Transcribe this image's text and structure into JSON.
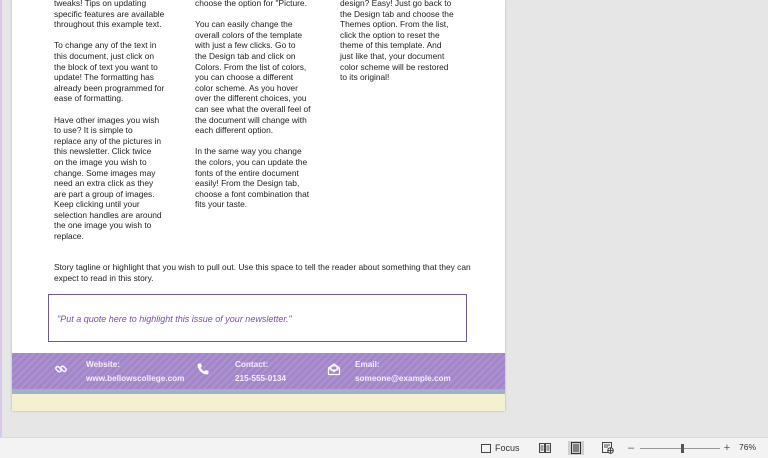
{
  "document": {
    "column1": [
      "tweaks!  Tips on updating\nspecific features are available\nthroughout this example text.",
      "To change any of the text in\nthis document, just click on\nthe block of text you want to\nupdate!  The formatting has\nalready been programmed for\nease of formatting.",
      "Have other images you wish\nto use?  It is simple to\nreplace any of the pictures in\nthis newsletter.  Click twice\non the image you wish to\nchange.  Some images may\nneed an extra click as they\nare part a group of images.\nKeep clicking until your\nselection handles are around\nthe one image you wish to\nreplace."
    ],
    "column2": [
      "choose the option for \"Picture.",
      "You can easily change the\noverall colors of the template\nwith just a few clicks.  Go to\nthe Design tab and click on\nColors.  From the list of colors,\nyou can choose a different\ncolor scheme.  As you hover\nover the different choices, you\ncan see what the overall feel of\nthe document will change with\neach different option.",
      "In the same way you change\nthe colors, you can update the\nfonts of the entire document\neasily!  From the Design tab,\nchoose a font combination that\nfits your taste."
    ],
    "column3": [
      "design?  Easy!  Just go back to\nthe Design tab and choose the\nThemes option.  From the list,\nclick the option to reset the\ntheme of this template.  And\njust like that, your document\ncolor scheme will be restored\nto its original!"
    ],
    "tagline": "Story tagline or highlight that you wish to pull out.  Use this space to tell the reader about something that they can expect to read in this story.",
    "quote": "\"Put a quote here to highlight this issue of your newsletter.\"",
    "footer": {
      "website_label": "Website:",
      "website_value": "www.bellowscollege.com",
      "contact_label": "Contact:",
      "contact_value": "215-555-0134",
      "email_label": "Email:",
      "email_value": "someone@example.com",
      "band_color": "#a386c9"
    }
  },
  "status_bar": {
    "focus_label": "Focus",
    "zoom_level": "76%",
    "zoom_fraction": 0.52,
    "active_view": "print-layout",
    "icons": [
      "focus-icon",
      "read-mode-icon",
      "print-layout-icon",
      "web-layout-icon"
    ]
  }
}
